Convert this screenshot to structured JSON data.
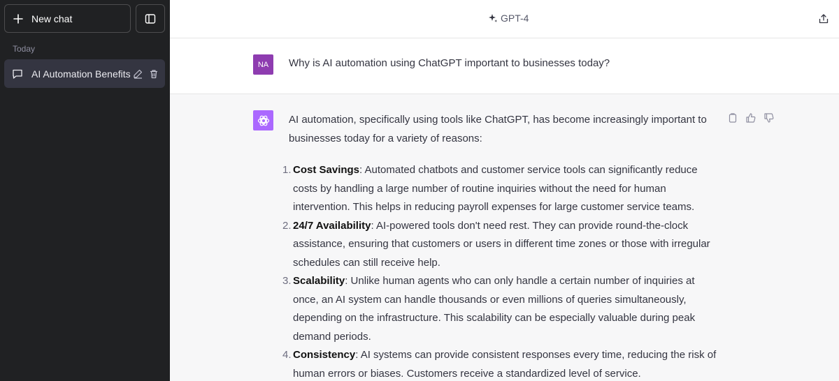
{
  "sidebar": {
    "new_chat_label": "New chat",
    "section_label": "Today",
    "chats": [
      {
        "label": "AI Automation Benefits"
      }
    ]
  },
  "header": {
    "model_label": "GPT-4"
  },
  "conversation": {
    "user": {
      "initials": "NA",
      "message": "Why is AI automation using ChatGPT important to businesses today?"
    },
    "assistant": {
      "intro": "AI automation, specifically using tools like ChatGPT, has become increasingly important to businesses today for a variety of reasons:",
      "points": [
        {
          "number": "1.",
          "title": "Cost Savings",
          "text": ": Automated chatbots and customer service tools can significantly reduce costs by handling a large number of routine inquiries without the need for human intervention. This helps in reducing payroll expenses for large customer service teams."
        },
        {
          "number": "2.",
          "title": "24/7 Availability",
          "text": ": AI-powered tools don't need rest. They can provide round-the-clock assistance, ensuring that customers or users in different time zones or those with irregular schedules can still receive help."
        },
        {
          "number": "3.",
          "title": "Scalability",
          "text": ": Unlike human agents who can only handle a certain number of inquiries at once, an AI system can handle thousands or even millions of queries simultaneously, depending on the infrastructure. This scalability can be especially valuable during peak demand periods."
        },
        {
          "number": "4.",
          "title": "Consistency",
          "text": ": AI systems can provide consistent responses every time, reducing the risk of human errors or biases. Customers receive a standardized level of service."
        }
      ]
    }
  },
  "colors": {
    "sidebar_bg": "#202123",
    "user_avatar": "#8e3cb0",
    "assistant_avatar": "#ab68ff",
    "assistant_bg": "#f7f7f8"
  },
  "icons": [
    "plus-icon",
    "sidebar-toggle-icon",
    "chat-bubble-icon",
    "edit-icon",
    "trash-icon",
    "sparkle-icon",
    "share-icon",
    "openai-logo-icon",
    "copy-icon",
    "thumbs-up-icon",
    "thumbs-down-icon"
  ]
}
